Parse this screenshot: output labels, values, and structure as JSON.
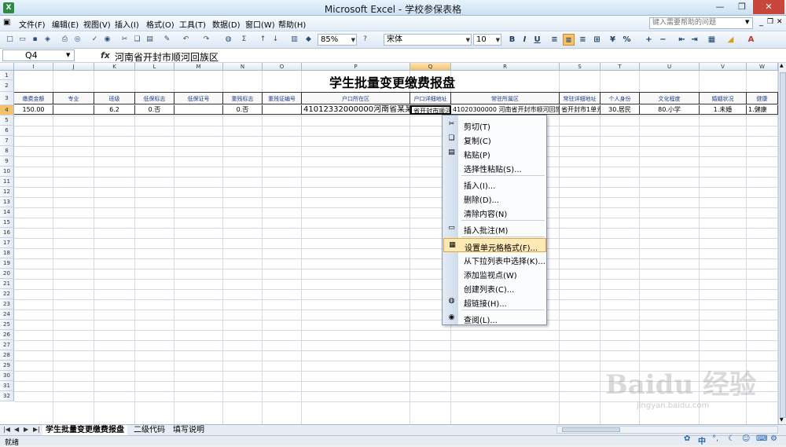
{
  "window": {
    "title": "Microsoft Excel - 学校参保表格"
  },
  "menubar": {
    "items": [
      "文件(F)",
      "编辑(E)",
      "视图(V)",
      "插入(I)",
      "格式(O)",
      "工具(T)",
      "数据(D)",
      "窗口(W)",
      "帮助(H)"
    ],
    "help_placeholder": "键入需要帮助的问题"
  },
  "toolbar": {
    "zoom": "85%",
    "font_name": "宋体",
    "font_size": "10"
  },
  "formula_bar": {
    "name_box": "Q4",
    "fx": "fx",
    "content": "河南省开封市顺河回族区"
  },
  "grid": {
    "columns": [
      "I",
      "J",
      "K",
      "L",
      "M",
      "N",
      "O",
      "P",
      "Q",
      "R",
      "S",
      "T",
      "U",
      "V",
      "W"
    ],
    "rows": [
      "1",
      "2",
      "3",
      "4",
      "5",
      "6",
      "7",
      "8",
      "9",
      "10",
      "11",
      "12",
      "13",
      "14",
      "15",
      "16",
      "17",
      "18",
      "19",
      "20",
      "21",
      "22",
      "23",
      "24",
      "25",
      "26",
      "27",
      "28",
      "29",
      "30",
      "31",
      "32"
    ],
    "title": "学生批量变更缴费报盘",
    "headers": [
      "缴费金额",
      "专业",
      "班级",
      "低保标志",
      "低保证号",
      "重残标志",
      "重残证编号",
      "户口所在区",
      "户口详细地址",
      "常驻所属区",
      "常驻详细地址",
      "个人身份",
      "文化程度",
      "婚姻状况",
      "健康"
    ],
    "row4": [
      "150.00",
      "",
      "6.2",
      "0.否",
      "",
      "0.否",
      "",
      "41012332000000河南省某某县",
      "省开封市顺河回",
      "41020300000 河南省开封市顺河回族",
      "省开封市1单元",
      "30.居民",
      "80.小学",
      "1.未婚",
      "1.健康"
    ]
  },
  "context_menu": {
    "items": [
      {
        "label": "剪切(T)",
        "icon": "scissors-icon"
      },
      {
        "label": "复制(C)",
        "icon": "copy-icon"
      },
      {
        "label": "粘贴(P)",
        "icon": "paste-icon"
      },
      {
        "label": "选择性粘贴(S)...",
        "icon": ""
      },
      {
        "label": "插入(I)...",
        "icon": ""
      },
      {
        "label": "删除(D)...",
        "icon": ""
      },
      {
        "label": "清除内容(N)",
        "icon": ""
      },
      {
        "label": "插入批注(M)",
        "icon": "comment-icon"
      },
      {
        "label": "设置单元格格式(F)...",
        "icon": "format-cells-icon"
      },
      {
        "label": "从下拉列表中选择(K)...",
        "icon": ""
      },
      {
        "label": "添加监视点(W)",
        "icon": ""
      },
      {
        "label": "创建列表(C)...",
        "icon": ""
      },
      {
        "label": "超链接(H)...",
        "icon": "hyperlink-icon"
      },
      {
        "label": "查阅(L)...",
        "icon": "research-icon"
      }
    ]
  },
  "sheet_tabs": [
    "学生批量变更缴费报盘",
    "二级代码",
    "填写说明"
  ],
  "status": {
    "text": "就绪",
    "ime": "中"
  },
  "watermark": {
    "brand": "Baidu 经验",
    "url": "jingyan.baidu.com"
  },
  "colors": {
    "highlight": "#f5c26c",
    "header_text": "#1f3c8f"
  }
}
